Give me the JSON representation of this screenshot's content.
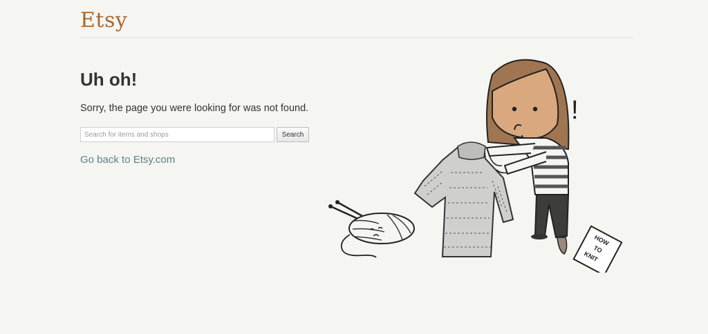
{
  "header": {
    "logo_text": "Etsy"
  },
  "main": {
    "heading": "Uh oh!",
    "message": "Sorry, the page you were looking for was not found.",
    "search": {
      "placeholder": "Search for items and shops",
      "value": "",
      "button_label": "Search"
    },
    "back_link": "Go back to Etsy.com"
  },
  "illustration": {
    "note_text": [
      "HOW",
      "TO",
      "KNIT"
    ],
    "exclamation": "!"
  },
  "colors": {
    "background": "#f5f5f1",
    "logo": "#a8672e",
    "link": "#5f7f86",
    "text": "#333333"
  }
}
